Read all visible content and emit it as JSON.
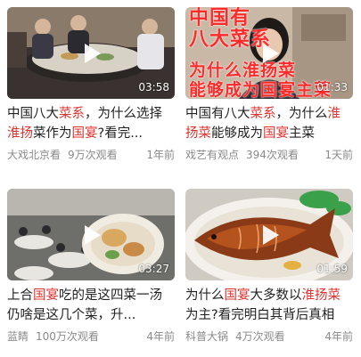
{
  "cards": [
    {
      "title_parts": [
        {
          "text": "中国八大",
          "hl": false
        },
        {
          "text": "菜系",
          "hl": true
        },
        {
          "text": "，为什么选择",
          "hl": false
        },
        {
          "text": "淮扬",
          "hl": true
        },
        {
          "text": "菜作为",
          "hl": false
        },
        {
          "text": "国宴",
          "hl": true
        },
        {
          "text": "?看完...",
          "hl": false
        }
      ],
      "source": "大戏北京看",
      "views": "9万次观看",
      "age": "1年前",
      "duration": "03:58",
      "thumb_icon": "dinner-table-scene",
      "overlay_lines": []
    },
    {
      "title_parts": [
        {
          "text": "中国有八大",
          "hl": false
        },
        {
          "text": "菜系",
          "hl": true
        },
        {
          "text": "，为什么",
          "hl": false
        },
        {
          "text": "淮扬",
          "hl": true
        },
        {
          "text": "菜",
          "hl": true
        },
        {
          "text": "能够成为",
          "hl": false
        },
        {
          "text": "国宴",
          "hl": true
        },
        {
          "text": "主菜",
          "hl": false
        }
      ],
      "source": "戏艺有观点",
      "views": "394次观看",
      "age": "1天前",
      "duration": "01:33",
      "thumb_icon": "presenter-scene",
      "overlay_lines": [
        "中国有",
        "八大菜系",
        "为什么淮扬菜",
        "能够成为国宴主菜"
      ]
    },
    {
      "title_parts": [
        {
          "text": "上合",
          "hl": false
        },
        {
          "text": "国宴",
          "hl": true
        },
        {
          "text": "吃的是这四菜一汤仍啥是这几个菜，升...",
          "hl": false
        }
      ],
      "source": "蓝睛",
      "views": "100万次观看",
      "age": "4年前",
      "duration": "03:27",
      "thumb_icon": "banquet-hall-scene",
      "overlay_lines": []
    },
    {
      "title_parts": [
        {
          "text": "为什么",
          "hl": false
        },
        {
          "text": "国宴",
          "hl": true
        },
        {
          "text": "大多数以",
          "hl": false
        },
        {
          "text": "淮扬菜",
          "hl": true
        },
        {
          "text": "为主?看完明白其背后真相",
          "hl": false
        }
      ],
      "source": "科普大锅",
      "views": "4万次观看",
      "age": "4年前",
      "duration": "01:59",
      "thumb_icon": "braised-fish-dish",
      "overlay_lines": []
    }
  ],
  "colors": {
    "highlight": "#e0332e",
    "text": "#222222",
    "meta": "#8a8a8a"
  }
}
